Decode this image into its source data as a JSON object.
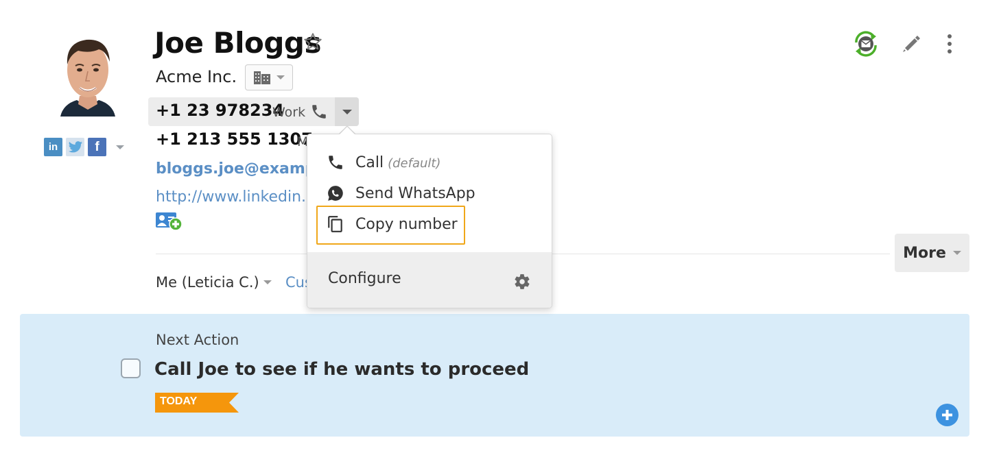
{
  "contact": {
    "name": "Joe Bloggs",
    "company": "Acme Inc.",
    "phones": [
      {
        "number": "+1 23 978234",
        "type": "Work"
      },
      {
        "number": "+1 213 555 1307",
        "type": "M"
      }
    ],
    "email": "bloggs.joe@exampl",
    "website": "http://www.linkedin.c",
    "owner": "Me (Leticia C.)",
    "custom_link": "Cus"
  },
  "social": {
    "linkedin_icon": "linkedin-icon",
    "twitter_icon": "twitter-icon",
    "facebook_icon": "facebook-icon",
    "linkedin_glyph": "in",
    "facebook_glyph": "f"
  },
  "actions": {
    "more_label": "More"
  },
  "phone_menu": {
    "items": [
      {
        "label": "Call",
        "note": "(default)",
        "icon": "phone-icon"
      },
      {
        "label": "Send WhatsApp",
        "icon": "whatsapp-icon"
      },
      {
        "label": "Copy number",
        "icon": "copy-icon"
      }
    ],
    "configure_label": "Configure",
    "focus_color": "#f0a719"
  },
  "next_action": {
    "heading": "Next Action",
    "task": "Call Joe to see if he wants to proceed",
    "due_badge": "TODAY",
    "badge_color": "#f5960c",
    "panel_color": "#d9ecf9"
  },
  "colors": {
    "link": "#5b8fc5",
    "sync_green": "#4caf2a",
    "add_blue": "#3d92e0"
  }
}
